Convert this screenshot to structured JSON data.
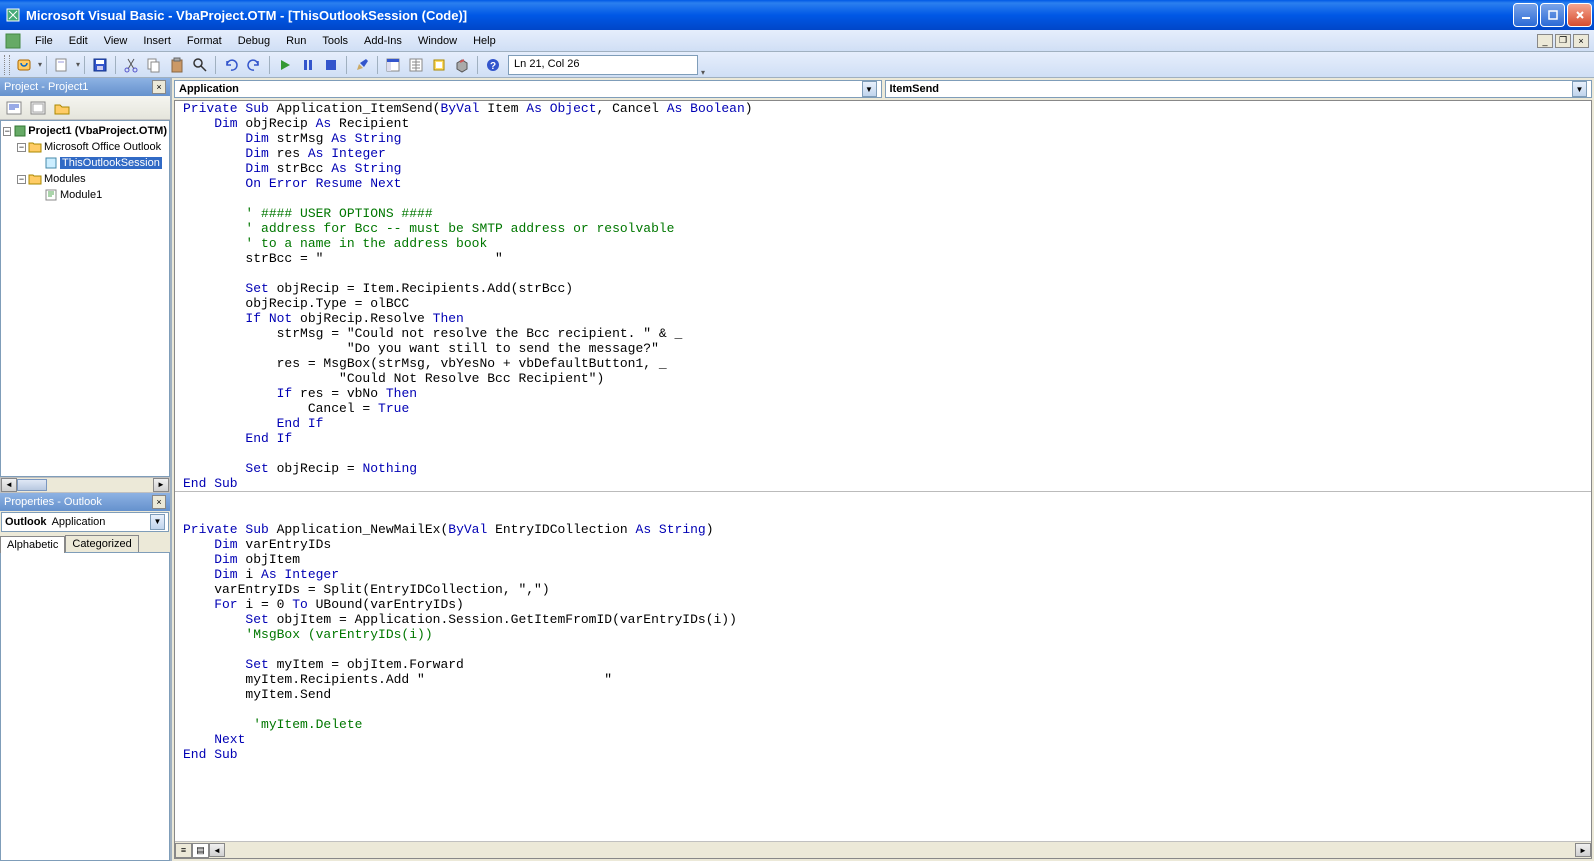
{
  "title": "Microsoft Visual Basic - VbaProject.OTM - [ThisOutlookSession (Code)]",
  "menu": {
    "file": "File",
    "edit": "Edit",
    "view": "View",
    "insert": "Insert",
    "format": "Format",
    "debug": "Debug",
    "run": "Run",
    "tools": "Tools",
    "addins": "Add-Ins",
    "window": "Window",
    "help": "Help"
  },
  "toolbar_status": "Ln 21, Col 26",
  "panels": {
    "project": {
      "title": "Project - Project1"
    },
    "props": {
      "title": "Properties - Outlook",
      "object": "Outlook",
      "type": "Application",
      "tab_alpha": "Alphabetic",
      "tab_cat": "Categorized"
    }
  },
  "tree": {
    "root": "Project1 (VbaProject.OTM)",
    "folder1": "Microsoft Office Outlook",
    "item1": "ThisOutlookSession",
    "folder2": "Modules",
    "item2": "Module1"
  },
  "code_dd": {
    "left": "Application",
    "right": "ItemSend"
  },
  "code": {
    "l1": {
      "a": "Private Sub",
      "b": " Application_ItemSend(",
      "c": "ByVal",
      "d": " Item ",
      "e": "As Object",
      "f": ", Cancel ",
      "g": "As Boolean",
      "h": ")"
    },
    "l2": {
      "a": "    Dim",
      "b": " objRecip ",
      "c": "As",
      "d": " Recipient"
    },
    "l3": {
      "a": "        Dim",
      "b": " strMsg ",
      "c": "As String"
    },
    "l4": {
      "a": "        Dim",
      "b": " res ",
      "c": "As Integer"
    },
    "l5": {
      "a": "        Dim",
      "b": " strBcc ",
      "c": "As String"
    },
    "l6": {
      "a": "        On Error Resume Next"
    },
    "l7": "",
    "l8": {
      "a": "        ' #### USER OPTIONS ####"
    },
    "l9": {
      "a": "        ' address for Bcc -- must be SMTP address or resolvable"
    },
    "l10": {
      "a": "        ' to a name in the address book"
    },
    "l11": "        strBcc = \"                      \"",
    "l12": "",
    "l13": {
      "a": "        Set",
      "b": " objRecip = Item.Recipients.Add(strBcc)"
    },
    "l14": "        objRecip.Type = olBCC",
    "l15": {
      "a": "        If Not",
      "b": " objRecip.Resolve ",
      "c": "Then"
    },
    "l16": "            strMsg = \"Could not resolve the Bcc recipient. \" & _",
    "l17": "                     \"Do you want still to send the message?\"",
    "l18": "            res = MsgBox(strMsg, vbYesNo + vbDefaultButton1, _",
    "l19": "                    \"Could Not Resolve Bcc Recipient\")",
    "l20": {
      "a": "            If",
      "b": " res = vbNo ",
      "c": "Then"
    },
    "l21": {
      "a": "                Cancel = ",
      "b": "True"
    },
    "l22": {
      "a": "            End If"
    },
    "l23": {
      "a": "        End If"
    },
    "l24": "",
    "l25": {
      "a": "        Set",
      "b": " objRecip = ",
      "c": "Nothing"
    },
    "l26": {
      "a": "End Sub"
    },
    "l27": "",
    "l28": "",
    "l29": {
      "a": "Private Sub",
      "b": " Application_NewMailEx(",
      "c": "ByVal",
      "d": " EntryIDCollection ",
      "e": "As String",
      "f": ")"
    },
    "l30": {
      "a": "    Dim",
      "b": " varEntryIDs"
    },
    "l31": {
      "a": "    Dim",
      "b": " objItem"
    },
    "l32": {
      "a": "    Dim",
      "b": " i ",
      "c": "As Integer"
    },
    "l33": "    varEntryIDs = Split(EntryIDCollection, \",\")",
    "l34": {
      "a": "    For",
      "b": " i = 0 ",
      "c": "To",
      "d": " UBound(varEntryIDs)"
    },
    "l35": {
      "a": "        Set",
      "b": " objItem = Application.Session.GetItemFromID(varEntryIDs(i))"
    },
    "l36": {
      "a": "        'MsgBox (varEntryIDs(i))"
    },
    "l37": "",
    "l38": {
      "a": "        Set",
      "b": " myItem = objItem.Forward"
    },
    "l39": "        myItem.Recipients.Add \"                       \"",
    "l40": "        myItem.Send",
    "l41": "",
    "l42": {
      "a": "         'myItem.Delete"
    },
    "l43": {
      "a": "    Next"
    },
    "l44": {
      "a": "End Sub"
    }
  }
}
